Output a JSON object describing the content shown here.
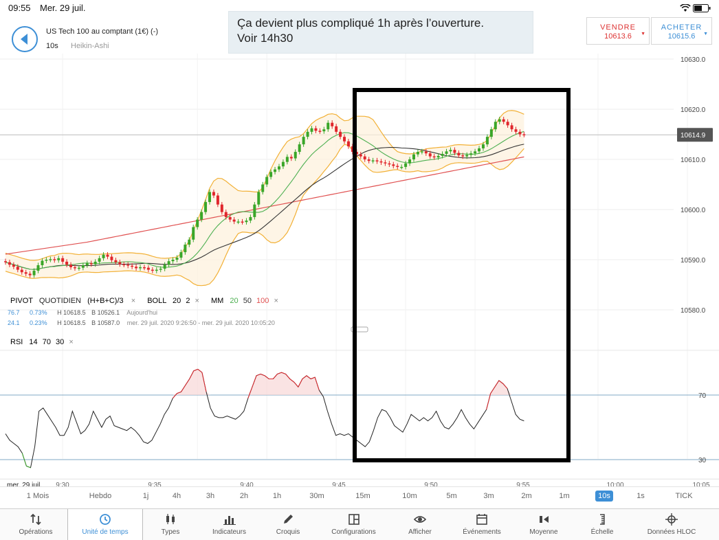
{
  "status_bar": {
    "time": "09:55",
    "date": "Mer. 29 juil.",
    "battery_icon": "battery-icon",
    "wifi_icon": "wifi-icon"
  },
  "header": {
    "instrument": "US Tech 100 au comptant (1€) (-)",
    "timeframe": "10s",
    "chart_type": "Heikin-Ashi"
  },
  "annotation": {
    "line1": "Ça devient plus compliqué 1h après l’ouverture.",
    "line2": "Voir 14h30"
  },
  "trade": {
    "sell_label": "VENDRE",
    "sell_price": "10613.6",
    "buy_label": "ACHETER",
    "buy_price": "10615.6"
  },
  "indicators": {
    "pivot_label": "PIVOT",
    "pivot_type": "QUOTIDIEN",
    "pivot_formula": "(H+B+C)/3",
    "boll_label": "BOLL",
    "boll_p1": "20",
    "boll_p2": "2",
    "mm_label": "MM",
    "mm_p1": "20",
    "mm_p2": "50",
    "mm_p3": "100",
    "row1": {
      "v1": "76.7",
      "v2": "0.73%",
      "h": "H 10618.5",
      "b": "B 10526.1",
      "period": "Aujourd'hui"
    },
    "row2": {
      "v1": "24.1",
      "v2": "0.23%",
      "h": "H 10618.5",
      "b": "B 10587.0",
      "period": "mer. 29 juil. 2020 9:26:50 - mer. 29 juil. 2020 10:05:20"
    },
    "rsi_label": "RSI",
    "rsi_p1": "14",
    "rsi_p2": "70",
    "rsi_p3": "30",
    "remove_symbol": "×"
  },
  "colors": {
    "up": "#3aa629",
    "down": "#e0262c",
    "accent": "#3d8fd6",
    "boll": "#f2b035",
    "mm20": "#4caf50",
    "mm50": "#333333",
    "mm100": "#e05050"
  },
  "chart_data": {
    "type": "candlestick",
    "price_axis": {
      "ticks": [
        "10630.0",
        "10620.0",
        "10610.0",
        "10600.0",
        "10590.0",
        "10580.0"
      ],
      "current_price": "10614.9",
      "range": [
        10578,
        10633
      ]
    },
    "rsi_axis": {
      "ticks": [
        "70",
        "30"
      ],
      "range": [
        18,
        96
      ]
    },
    "time_axis": {
      "first_label": "mer. 29 juil.",
      "ticks": [
        "9:30",
        "9:35",
        "9:40",
        "9:45",
        "9:50",
        "9:55",
        "10:00",
        "10:05"
      ]
    },
    "candles_close": [
      10589.5,
      10589.0,
      10588.6,
      10588.0,
      10587.5,
      10587.2,
      10586.9,
      10587.8,
      10588.9,
      10589.8,
      10590.0,
      10590.1,
      10589.9,
      10590.3,
      10589.6,
      10589.0,
      10588.5,
      10588.3,
      10588.4,
      10588.9,
      10589.3,
      10589.1,
      10589.6,
      10590.3,
      10591.0,
      10590.6,
      10589.9,
      10589.5,
      10589.1,
      10589.0,
      10588.8,
      10588.6,
      10588.3,
      10588.5,
      10588.4,
      10588.0,
      10587.8,
      10588.0,
      10588.2,
      10589.0,
      10589.7,
      10590.0,
      10590.4,
      10591.5,
      10593.0,
      10594.0,
      10596.5,
      10598.0,
      10599.5,
      10601.5,
      10603.5,
      10602.8,
      10601.0,
      10599.5,
      10598.5,
      10598.0,
      10597.6,
      10597.6,
      10597.5,
      10597.8,
      10598.5,
      10601.0,
      10603.5,
      10605.0,
      10606.5,
      10607.5,
      10608.0,
      10608.6,
      10609.5,
      10610.5,
      10610.2,
      10611.5,
      10613.0,
      10614.5,
      10615.5,
      10616.2,
      10615.7,
      10615.6,
      10616.0,
      10617.3,
      10616.6,
      10615.5,
      10614.5,
      10613.6,
      10612.6,
      10611.5,
      10611.0,
      10610.6,
      10610.0,
      10609.7,
      10609.8,
      10609.6,
      10609.4,
      10609.2,
      10609.0,
      10608.7,
      10608.5,
      10608.5,
      10609.2,
      10610.0,
      10611.0,
      10611.5,
      10611.6,
      10611.2,
      10610.6,
      10610.4,
      10610.7,
      10611.1,
      10611.6,
      10611.9,
      10611.3,
      10610.8,
      10610.6,
      10610.9,
      10611.2,
      10611.6,
      10612.2,
      10613.0,
      10614.5,
      10616.0,
      10617.5,
      10618.0,
      10617.5,
      10616.8,
      10616.0,
      10615.5,
      10615.0,
      10614.9
    ],
    "candles_open": [
      10589.7,
      10589.5,
      10589.0,
      10588.6,
      10588.0,
      10587.5,
      10587.2,
      10586.9,
      10587.8,
      10588.9,
      10589.8,
      10590.0,
      10590.1,
      10589.9,
      10590.3,
      10589.6,
      10589.0,
      10588.5,
      10588.3,
      10588.4,
      10588.9,
      10589.3,
      10589.1,
      10589.6,
      10590.3,
      10591.0,
      10590.6,
      10589.9,
      10589.5,
      10589.1,
      10589.0,
      10588.8,
      10588.6,
      10588.3,
      10588.5,
      10588.4,
      10588.0,
      10587.8,
      10588.0,
      10588.2,
      10589.0,
      10589.7,
      10590.0,
      10590.4,
      10591.5,
      10593.0,
      10594.0,
      10596.5,
      10598.0,
      10599.5,
      10601.5,
      10603.5,
      10602.8,
      10601.0,
      10599.5,
      10598.5,
      10598.0,
      10597.6,
      10597.6,
      10597.5,
      10597.8,
      10598.5,
      10601.0,
      10603.5,
      10605.0,
      10606.5,
      10607.5,
      10608.0,
      10608.6,
      10609.5,
      10610.5,
      10610.2,
      10611.5,
      10613.0,
      10614.5,
      10615.5,
      10616.2,
      10615.7,
      10615.6,
      10616.0,
      10617.3,
      10616.6,
      10615.5,
      10614.5,
      10613.6,
      10612.6,
      10611.5,
      10611.0,
      10610.6,
      10610.0,
      10609.7,
      10609.8,
      10609.6,
      10609.4,
      10609.2,
      10609.0,
      10608.7,
      10608.5,
      10608.5,
      10609.2,
      10610.0,
      10611.0,
      10611.5,
      10611.6,
      10611.2,
      10610.6,
      10610.4,
      10610.7,
      10611.1,
      10611.6,
      10611.9,
      10611.3,
      10610.8,
      10610.6,
      10610.9,
      10611.2,
      10611.6,
      10612.2,
      10613.0,
      10614.5,
      10616.0,
      10617.5,
      10618.0,
      10617.5,
      10616.8,
      10616.0,
      10615.5,
      10615.0
    ],
    "rsi": [
      46,
      42,
      40,
      38,
      34,
      26,
      25,
      38,
      60,
      62,
      58,
      54,
      50,
      45,
      45,
      50,
      60,
      53,
      46,
      48,
      52,
      60,
      55,
      50,
      55,
      57,
      51,
      50,
      49,
      48,
      50,
      48,
      45,
      41,
      40,
      42,
      47,
      52,
      58,
      62,
      68,
      71,
      72,
      76,
      80,
      85,
      86,
      84,
      72,
      62,
      57,
      56,
      56,
      57,
      56,
      55,
      57,
      60,
      68,
      75,
      82,
      83,
      82,
      80,
      80,
      83,
      84,
      83,
      80,
      78,
      75,
      80,
      82,
      80,
      81,
      73,
      69,
      60,
      52,
      45,
      46,
      45,
      46,
      44,
      42,
      40,
      38,
      41,
      48,
      56,
      61,
      60,
      56,
      51,
      49,
      47,
      52,
      58,
      56,
      54,
      56,
      54,
      56,
      60,
      54,
      50,
      49,
      52,
      56,
      61,
      56,
      52,
      49,
      53,
      57,
      61,
      71,
      75,
      79,
      77,
      74,
      66,
      58,
      55,
      54
    ]
  },
  "timeframes": {
    "items": [
      "1 Mois",
      "Hebdo",
      "1j",
      "4h",
      "3h",
      "2h",
      "1h",
      "30m",
      "15m",
      "10m",
      "5m",
      "3m",
      "2m",
      "1m",
      "10s",
      "1s",
      "TICK"
    ],
    "active": "10s"
  },
  "toolbar": {
    "items": [
      {
        "label": "Opérations",
        "icon": "transactions-icon"
      },
      {
        "label": "Unité de temps",
        "icon": "clock-icon"
      },
      {
        "label": "Types",
        "icon": "candlestick-icon"
      },
      {
        "label": "Indicateurs",
        "icon": "bar-chart-icon"
      },
      {
        "label": "Croquis",
        "icon": "pencil-icon"
      },
      {
        "label": "Configurations",
        "icon": "layout-icon"
      },
      {
        "label": "Afficher",
        "icon": "eye-icon"
      },
      {
        "label": "Événements",
        "icon": "calendar-icon"
      },
      {
        "label": "Moyenne",
        "icon": "average-icon"
      },
      {
        "label": "Échelle",
        "icon": "scale-icon"
      },
      {
        "label": "Données HLOC",
        "icon": "crosshair-icon"
      }
    ],
    "active": "Unité de temps"
  }
}
